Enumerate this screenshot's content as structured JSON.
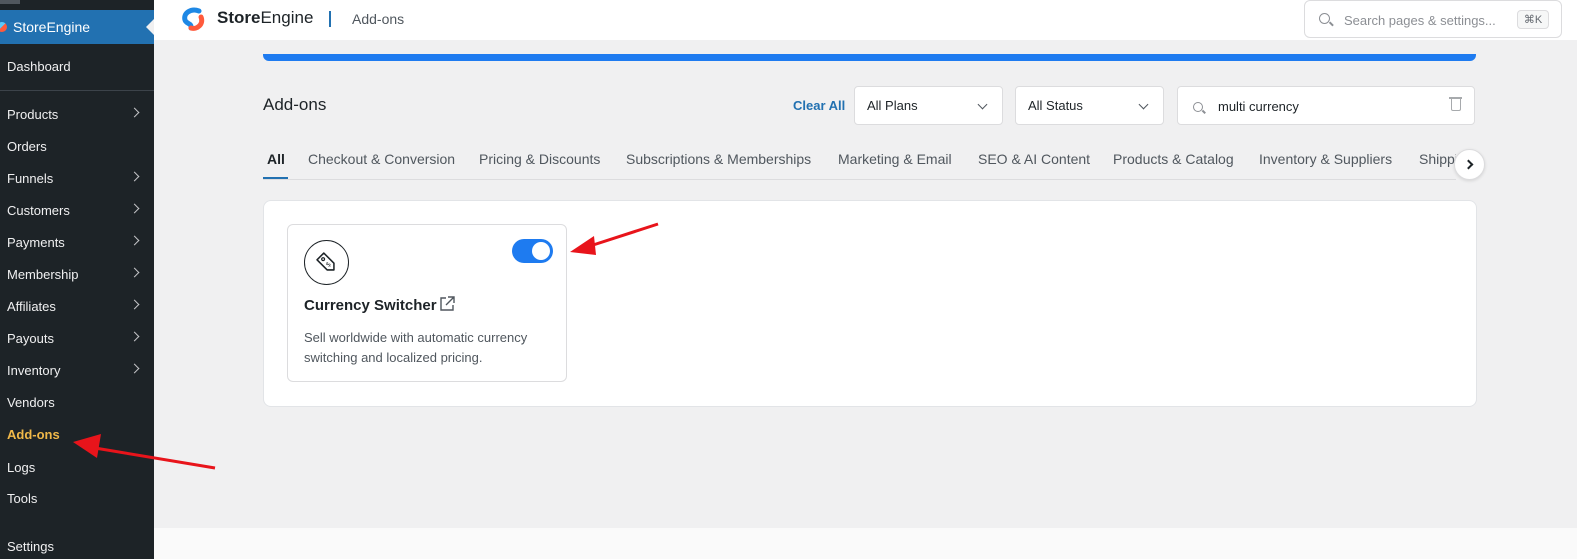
{
  "sidebar": {
    "brand": "StoreEngine",
    "items": [
      {
        "label": "Dashboard",
        "has_submenu": false
      },
      {
        "label": "Products",
        "has_submenu": true
      },
      {
        "label": "Orders",
        "has_submenu": false
      },
      {
        "label": "Funnels",
        "has_submenu": true
      },
      {
        "label": "Customers",
        "has_submenu": true
      },
      {
        "label": "Payments",
        "has_submenu": true
      },
      {
        "label": "Membership",
        "has_submenu": true
      },
      {
        "label": "Affiliates",
        "has_submenu": true
      },
      {
        "label": "Payouts",
        "has_submenu": true
      },
      {
        "label": "Inventory",
        "has_submenu": true
      },
      {
        "label": "Vendors",
        "has_submenu": false
      },
      {
        "label": "Add-ons",
        "has_submenu": false,
        "active": true
      },
      {
        "label": "Logs",
        "has_submenu": false
      },
      {
        "label": "Tools",
        "has_submenu": false
      },
      {
        "label": "Settings",
        "has_submenu": false
      }
    ]
  },
  "header": {
    "brand_bold": "Store",
    "brand_rest": "Engine",
    "page": "Add-ons",
    "search": {
      "placeholder": "Search pages & settings...",
      "shortcut": "⌘K"
    }
  },
  "toolbar": {
    "title": "Add-ons",
    "clear_all": "Clear All",
    "plan_filter": "All Plans",
    "status_filter": "All Status",
    "search_value": "multi currency"
  },
  "tabs": [
    {
      "label": "All",
      "active": true
    },
    {
      "label": "Checkout & Conversion"
    },
    {
      "label": "Pricing & Discounts"
    },
    {
      "label": "Subscriptions & Memberships"
    },
    {
      "label": "Marketing & Email"
    },
    {
      "label": "SEO & AI Content"
    },
    {
      "label": "Products & Catalog"
    },
    {
      "label": "Inventory & Suppliers"
    },
    {
      "label": "Shipping"
    }
  ],
  "addons": [
    {
      "title": "Currency Switcher",
      "description": "Sell worldwide with automatic currency switching and localized pricing.",
      "enabled": true,
      "icon": "price-tag-icon"
    }
  ],
  "colors": {
    "sidebar_bg": "#1d2327",
    "accent": "#2271b1",
    "toggle_on": "#1e7bf0",
    "active_menu": "#f0b849",
    "annotation_arrow": "#e8141b"
  }
}
